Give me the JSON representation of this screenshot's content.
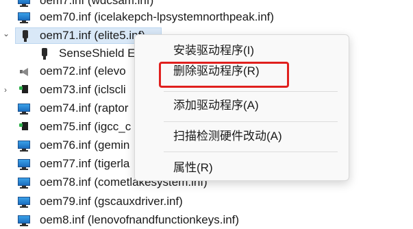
{
  "tree": {
    "items": [
      {
        "label": "oem7.inf (wdcsam.inf)"
      },
      {
        "label": "oem70.inf (icelakepch-lpsystemnorthpeak.inf)"
      },
      {
        "label": "oem71.inf (elite5.inf)"
      },
      {
        "label": "SenseShield E"
      },
      {
        "label": "oem72.inf (elevo"
      },
      {
        "label": "oem73.inf (iclscli"
      },
      {
        "label": "oem74.inf (raptor"
      },
      {
        "label": "oem75.inf (igcc_c"
      },
      {
        "label": "oem76.inf (gemin"
      },
      {
        "label": "oem77.inf (tigerla"
      },
      {
        "label": "oem78.inf (cometlakesystem.inf)"
      },
      {
        "label": "oem79.inf (gscauxdriver.inf)"
      },
      {
        "label": "oem8.inf (lenovofnandfunctionkeys.inf)"
      }
    ]
  },
  "context_menu": {
    "install": "安装驱动程序(I)",
    "delete": "删除驱动程序(R)",
    "add": "添加驱动程序(A)",
    "scan": "扫描检测硬件改动(A)",
    "properties": "属性(R)"
  },
  "colors": {
    "selection": "#d9e8f7",
    "highlight_box": "#e0201e"
  }
}
